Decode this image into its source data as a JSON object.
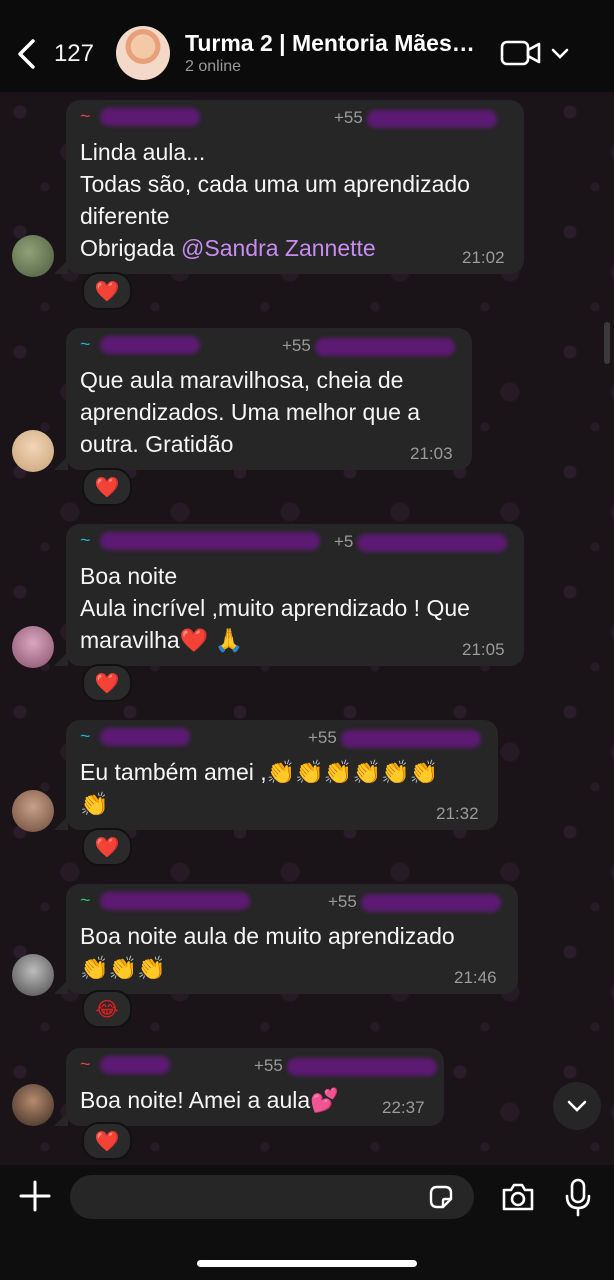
{
  "header": {
    "back_count": "127",
    "title": "Turma 2 | Mentoria Mães…",
    "subtitle": "2 online",
    "icons": [
      "chevron-left-icon",
      "video-call-icon",
      "chevron-down-icon"
    ]
  },
  "messages": [
    {
      "sender_prefix": "~",
      "phone_prefix": "+55",
      "lines_before": "Linda aula...\nTodas são, cada uma um aprendizado\ndiferente\nObrigada ",
      "mention": "@Sandra Zannette",
      "time": "21:02",
      "reaction": "❤️"
    },
    {
      "sender_prefix": "~",
      "phone_prefix": "+55",
      "text": "Que aula maravilhosa, cheia de\naprendizados. Uma melhor que a\noutra. Gratidão",
      "time": "21:03",
      "reaction": "❤️"
    },
    {
      "sender_prefix": "~",
      "phone_prefix": "+5",
      "text": "Boa noite\nAula incrível ,muito aprendizado ! Que\nmaravilha❤️ 🙏",
      "time": "21:05",
      "reaction": "❤️"
    },
    {
      "sender_prefix": "~",
      "phone_prefix": "+55",
      "text": "Eu também amei ,👏👏👏👏👏👏\n👏",
      "time": "21:32",
      "reaction": "❤️"
    },
    {
      "sender_prefix": "~",
      "phone_prefix": "+55",
      "text": "Boa noite aula de muito  aprendizado\n👏👏👏",
      "time": "21:46",
      "reaction": "😂"
    },
    {
      "sender_prefix": "~",
      "phone_prefix": "+55",
      "text": "Boa noite! Amei a aula💕",
      "time": "22:37",
      "reaction": "❤️"
    }
  ],
  "input": {
    "placeholder": ""
  },
  "colors": {
    "bubble": "#262626",
    "mention": "#c88cf0",
    "sender": "#1fb2d6",
    "redaction": "#5c1a72"
  }
}
